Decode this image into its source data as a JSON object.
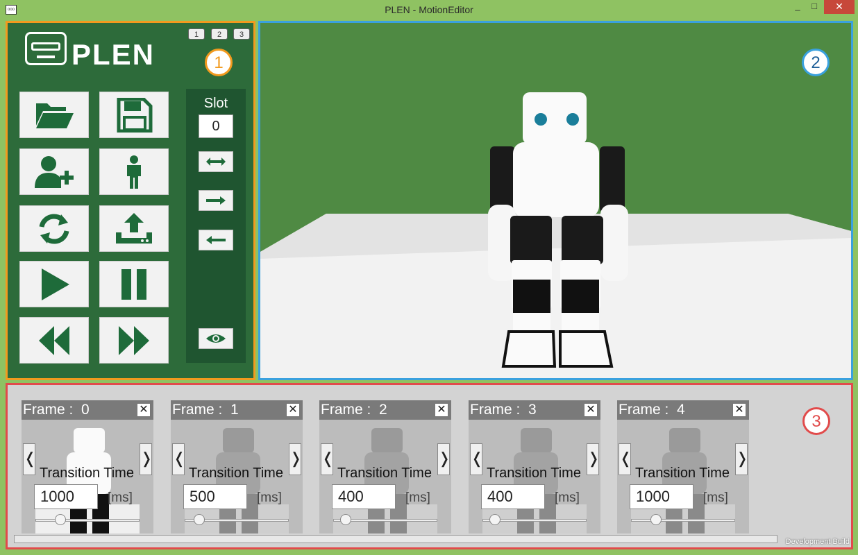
{
  "window": {
    "title": "PLEN - MotionEditor",
    "icon": "app-icon",
    "min": "_",
    "max": "□",
    "close": "✕"
  },
  "panel1": {
    "logo_text": "PLEN",
    "pages": [
      "1",
      "2",
      "3"
    ],
    "badge": "1",
    "buttons": [
      {
        "name": "open-button",
        "icon": "folder-open-icon"
      },
      {
        "name": "save-button",
        "icon": "floppy-disk-icon"
      },
      {
        "name": "add-user-button",
        "icon": "user-add-icon"
      },
      {
        "name": "person-button",
        "icon": "person-icon"
      },
      {
        "name": "refresh-button",
        "icon": "refresh-icon"
      },
      {
        "name": "upload-button",
        "icon": "upload-icon"
      },
      {
        "name": "play-button",
        "icon": "play-icon"
      },
      {
        "name": "pause-button",
        "icon": "pause-icon"
      },
      {
        "name": "rewind-button",
        "icon": "rewind-icon"
      },
      {
        "name": "fast-forward-button",
        "icon": "fast-forward-icon"
      }
    ],
    "slot": {
      "label": "Slot",
      "value": "0",
      "buttons": [
        "swap-arrows-icon",
        "arrow-right-icon",
        "arrow-left-icon",
        "eye-icon"
      ]
    }
  },
  "panel2": {
    "badge": "2",
    "colors": {
      "background": "#4f8a43",
      "floor": "#f2f2f2",
      "border": "#3aa1de"
    }
  },
  "panel3": {
    "badge": "3",
    "frames": [
      {
        "label": "Frame :  0",
        "transition_label": "Transition Time",
        "time": "1000",
        "unit": "[ms]",
        "slider": 0.24
      },
      {
        "label": "Frame :  1",
        "transition_label": "Transition Time",
        "time": "500",
        "unit": "[ms]",
        "slider": 0.14
      },
      {
        "label": "Frame :  2",
        "transition_label": "Transition Time",
        "time": "400",
        "unit": "[ms]",
        "slider": 0.12
      },
      {
        "label": "Frame :  3",
        "transition_label": "Transition Time",
        "time": "400",
        "unit": "[ms]",
        "slider": 0.12
      },
      {
        "label": "Frame :  4",
        "transition_label": "Transition Time",
        "time": "1000",
        "unit": "[ms]",
        "slider": 0.24
      }
    ],
    "close_glyph": "✕",
    "prev_glyph": "❬",
    "next_glyph": "❭",
    "footer": "Development Build"
  }
}
